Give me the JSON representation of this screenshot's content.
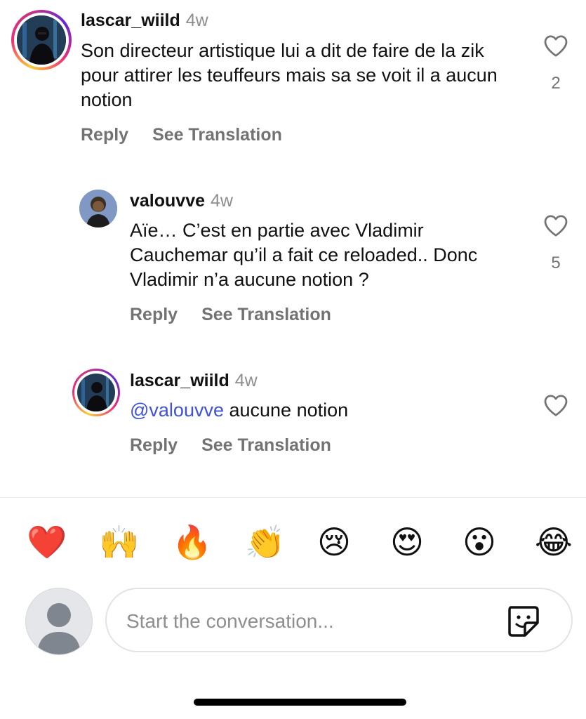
{
  "comments": [
    {
      "username": "lascar_wiild",
      "time": "4w",
      "text": "Son directeur artistique lui a dit de faire de la zik pour attirer les teuffeurs mais sa se voit il a aucun notion",
      "likes": "2",
      "reply_label": "Reply",
      "translate_label": "See Translation",
      "avatar": "story-ring-avatar"
    },
    {
      "username": "valouvve",
      "time": "4w",
      "text": "Aïe… C’est en partie avec Vladimir Cauchemar qu’il a fait ce reloaded.. Donc Vladimir n’a aucune notion ?",
      "likes": "5",
      "reply_label": "Reply",
      "translate_label": "See Translation",
      "avatar": "profile-avatar"
    },
    {
      "username": "lascar_wiild",
      "time": "4w",
      "mention": "@valouvve",
      "text": " aucune notion",
      "likes": "",
      "reply_label": "Reply",
      "translate_label": "See Translation",
      "avatar": "story-ring-avatar"
    }
  ],
  "reactions": [
    "❤️",
    "🙌",
    "🔥",
    "👏",
    "😢",
    "😍",
    "😮",
    "😂"
  ],
  "composer": {
    "placeholder": "Start the conversation...",
    "sticker_icon": "sticker-icon"
  },
  "colors": {
    "mention": "#3f51d9",
    "meta_gray": "#737373",
    "ring_gradient": [
      "#f9ce34",
      "#ee2a7b",
      "#6228d7"
    ]
  }
}
